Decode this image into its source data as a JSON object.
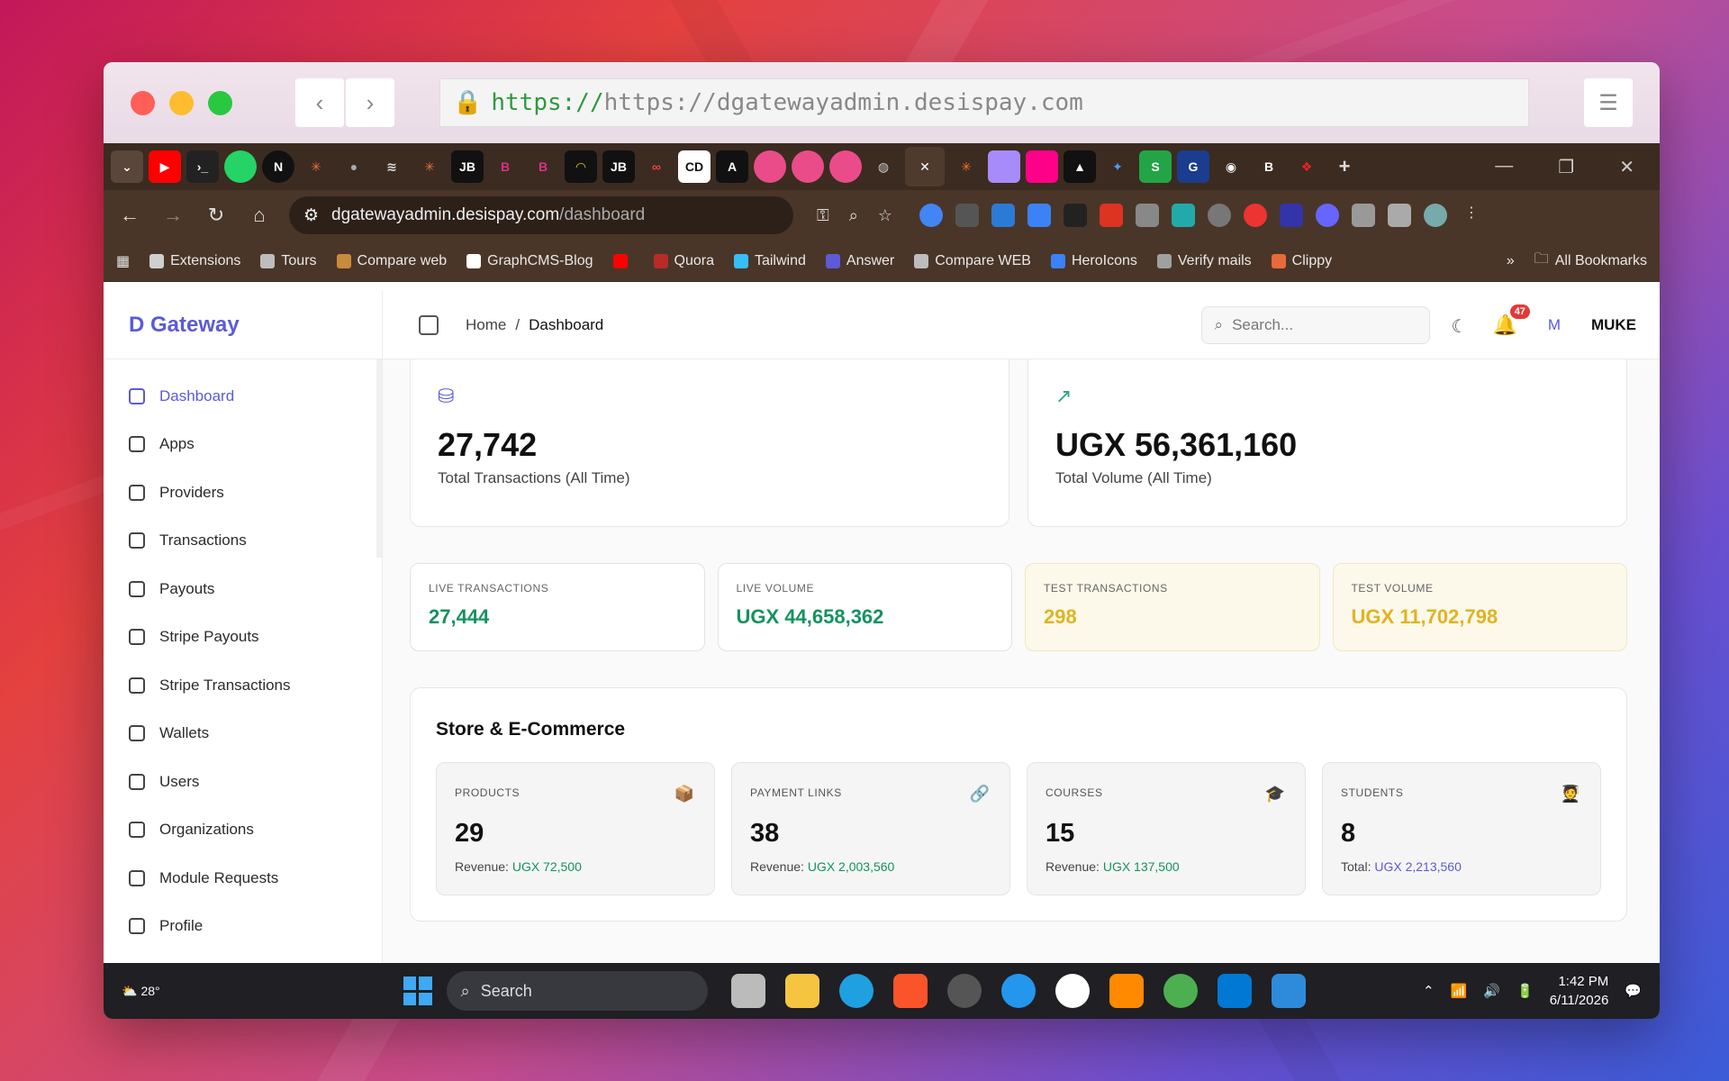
{
  "outer_browser": {
    "url_protocol": "https://",
    "url_rest": "https://dgatewayadmin.desispay.com"
  },
  "chrome": {
    "address": "dgatewayadmin.desispay.com",
    "address_path": "/dashboard",
    "bookmarks": [
      {
        "label": "Extensions",
        "color": "#cfcfcf"
      },
      {
        "label": "Tours",
        "color": "#bdbdbd"
      },
      {
        "label": "Compare web",
        "color": "#c88a3c"
      },
      {
        "label": "GraphCMS-Blog",
        "color": "#ffffff"
      },
      {
        "label": "",
        "color": "#ff0000"
      },
      {
        "label": "Quora",
        "color": "#b92b27"
      },
      {
        "label": "Tailwind",
        "color": "#38bdf8"
      },
      {
        "label": "Answer",
        "color": "#5b5bd6"
      },
      {
        "label": "Compare WEB",
        "color": "#bdbdbd"
      },
      {
        "label": "HeroIcons",
        "color": "#3b82f6"
      },
      {
        "label": "Verify mails",
        "color": "#a0a0a0"
      },
      {
        "label": "Clippy",
        "color": "#e86a3a"
      }
    ],
    "all_bookmarks": "All Bookmarks"
  },
  "app": {
    "brand": "D Gateway",
    "nav": [
      {
        "label": "Dashboard",
        "name": "sidebar-item-dashboard"
      },
      {
        "label": "Apps",
        "name": "sidebar-item-apps"
      },
      {
        "label": "Providers",
        "name": "sidebar-item-providers"
      },
      {
        "label": "Transactions",
        "name": "sidebar-item-transactions"
      },
      {
        "label": "Payouts",
        "name": "sidebar-item-payouts"
      },
      {
        "label": "Stripe Payouts",
        "name": "sidebar-item-stripe-payouts"
      },
      {
        "label": "Stripe Transactions",
        "name": "sidebar-item-stripe-transactions"
      },
      {
        "label": "Wallets",
        "name": "sidebar-item-wallets"
      },
      {
        "label": "Users",
        "name": "sidebar-item-users"
      },
      {
        "label": "Organizations",
        "name": "sidebar-item-organizations"
      },
      {
        "label": "Module Requests",
        "name": "sidebar-item-module-requests"
      },
      {
        "label": "Profile",
        "name": "sidebar-item-profile"
      }
    ],
    "breadcrumb": {
      "home": "Home",
      "sep": "/",
      "current": "Dashboard"
    },
    "search_placeholder": "Search...",
    "notifications": "47",
    "user_initial": "M",
    "user_name": "MUKE"
  },
  "overview": {
    "total_tx": {
      "value": "27,742",
      "label": "Total Transactions (All Time)"
    },
    "total_vol": {
      "value": "UGX 56,361,160",
      "label": "Total Volume (All Time)"
    }
  },
  "stats": [
    {
      "label": "LIVE TRANSACTIONS",
      "value": "27,444",
      "kind": "live"
    },
    {
      "label": "LIVE VOLUME",
      "value": "UGX 44,658,362",
      "kind": "live"
    },
    {
      "label": "TEST TRANSACTIONS",
      "value": "298",
      "kind": "test"
    },
    {
      "label": "TEST VOLUME",
      "value": "UGX 11,702,798",
      "kind": "test"
    }
  ],
  "store": {
    "title": "Store & E-Commerce",
    "cards": [
      {
        "label": "PRODUCTS",
        "icon": "📦",
        "value": "29",
        "sub_label": "Revenue:",
        "sub_value": "UGX 72,500",
        "accent": "green"
      },
      {
        "label": "PAYMENT LINKS",
        "icon": "🔗",
        "value": "38",
        "sub_label": "Revenue:",
        "sub_value": "UGX 2,003,560",
        "accent": "green"
      },
      {
        "label": "COURSES",
        "icon": "🎓",
        "value": "15",
        "sub_label": "Revenue:",
        "sub_value": "UGX 137,500",
        "accent": "green"
      },
      {
        "label": "STUDENTS",
        "icon": "🧑‍🎓",
        "value": "8",
        "sub_label": "Total:",
        "sub_value": "UGX 2,213,560",
        "accent": "purple"
      }
    ]
  },
  "taskbar": {
    "temp": "28°",
    "search": "Search",
    "time": "1:42 PM",
    "date": "6/11/2026"
  }
}
